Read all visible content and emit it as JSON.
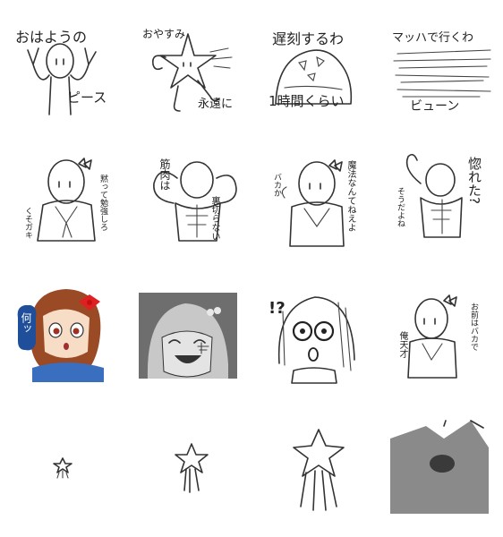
{
  "stickers": [
    {
      "name": "ohayou",
      "texts": [
        "おはようの",
        "ピース"
      ]
    },
    {
      "name": "oyasumi",
      "texts": [
        "おやすみ",
        "永遠に"
      ]
    },
    {
      "name": "chikoku",
      "texts": [
        "遅刻するわ",
        "1時間くらい"
      ]
    },
    {
      "name": "mach",
      "texts": [
        "マッハで行くわ",
        "ビューン"
      ]
    },
    {
      "name": "benkyou",
      "texts": [
        "黙って勉強しろ",
        "くそガキ"
      ]
    },
    {
      "name": "kinniku",
      "texts": [
        "筋肉は",
        "裏切らない"
      ]
    },
    {
      "name": "mahou",
      "texts": [
        "魔法なんてねえよ",
        "バカか"
      ]
    },
    {
      "name": "horeta",
      "texts": [
        "惚れた?",
        "そうだよね"
      ]
    },
    {
      "name": "nani",
      "texts": [
        "何ッ"
      ]
    },
    {
      "name": "laugh",
      "texts": []
    },
    {
      "name": "shock",
      "texts": [
        "!?"
      ]
    },
    {
      "name": "tensai",
      "texts": [
        "お前はバカで",
        "俺天才"
      ]
    },
    {
      "name": "star-tiny",
      "texts": []
    },
    {
      "name": "star-small",
      "texts": []
    },
    {
      "name": "star-medium",
      "texts": []
    },
    {
      "name": "star-zoom",
      "texts": []
    }
  ],
  "colors": {
    "ink": "#222222",
    "dark-bg": "#6e6e6e",
    "zoom-bg": "#8a8a8a",
    "hair": "#9a4a24",
    "bow": "#e02020",
    "bubble": "#1f4f9a",
    "uniform": "#3a6fc0"
  }
}
